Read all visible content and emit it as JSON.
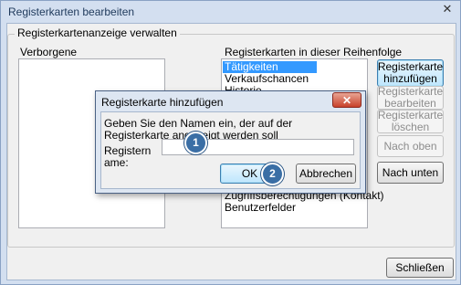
{
  "window": {
    "title": "Registerkarten bearbeiten",
    "close_glyph": "✕"
  },
  "group": {
    "legend": "Registerkartenanzeige verwalten"
  },
  "hidden_list": {
    "label": "Verborgene"
  },
  "order_list": {
    "label": "Registerkarten in dieser Reihenfolge",
    "items": [
      "Tätigkeiten",
      "Verkaufschancen",
      "Historie"
    ],
    "items_below": [
      "Zugriffsberechtigungen (Kontakt)",
      "Benutzerfelder"
    ],
    "selected_index": 0
  },
  "side_buttons": {
    "add": "Registerkarte hinzufügen",
    "edit": "Registerkarte bearbeiten",
    "delete": "Registerkarte löschen",
    "up": "Nach oben",
    "down": "Nach unten"
  },
  "dialog": {
    "title": "Registerkarte hinzufügen",
    "close_glyph": "✕",
    "instruction": "Geben Sie den Namen ein, der auf der Registerkarte angezeigt werden soll",
    "name_label": "Registername:",
    "name_value": "",
    "ok": "OK",
    "cancel": "Abbrechen"
  },
  "callouts": [
    "1",
    "2"
  ],
  "close_button": "Schließen",
  "colors": {
    "selected_bg": "#3399ff",
    "badge": "#3a6ea5",
    "focus_border": "#3c7fb1"
  }
}
